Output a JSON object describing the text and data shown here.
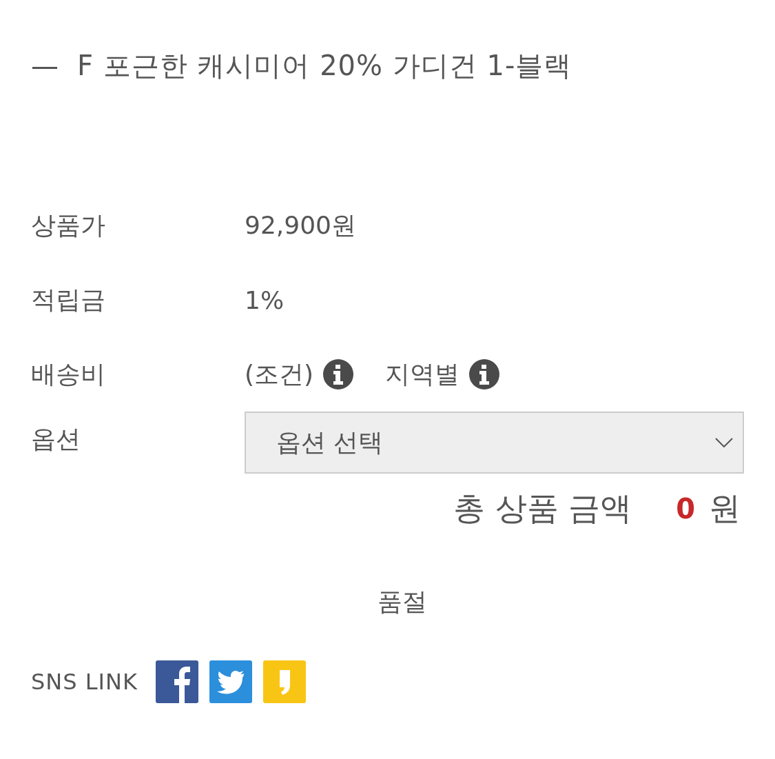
{
  "title": {
    "dash": "—",
    "text": "F 포근한 캐시미어 20% 가디건 1-블랙"
  },
  "rows": [
    {
      "kind": "text",
      "label": "상품가",
      "value": "92,900원"
    },
    {
      "kind": "text",
      "label": "적립금",
      "value": "1%"
    },
    {
      "kind": "info",
      "label": "배송비",
      "parts": [
        "(조건)",
        "지역별"
      ]
    },
    {
      "kind": "select",
      "label": "옵션",
      "value": "옵션 선택"
    }
  ],
  "total": {
    "label": "총 상품 금액",
    "amount": "0",
    "unit": "원"
  },
  "sold_out": "품절",
  "sns": {
    "label": "SNS LINK",
    "links": [
      {
        "kind": "facebook"
      },
      {
        "kind": "twitter"
      },
      {
        "kind": "story"
      }
    ]
  }
}
